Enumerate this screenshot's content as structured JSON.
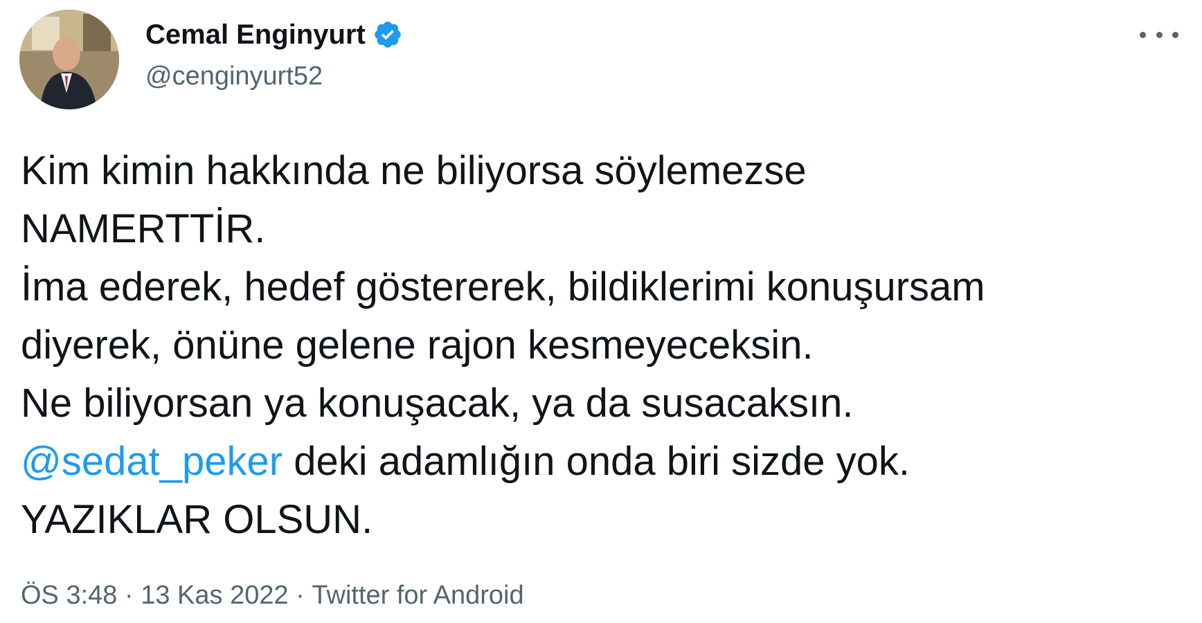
{
  "author": {
    "name": "Cemal Enginyurt",
    "handle": "@cenginyurt52",
    "verified_icon": "verified-badge-icon"
  },
  "more_icon": "more-horizontal-icon",
  "tweet": {
    "lines": [
      "Kim kimin hakkında ne biliyorsa söylemezse",
      "NAMERTTİR.",
      "İma ederek, hedef göstererek, bildiklerimi konuşursam",
      "diyerek, önüne gelene rajon kesmeyeceksin.",
      "Ne biliyorsan ya konuşacak, ya da susacaksın."
    ],
    "mention": "@sedat_peker",
    "mention_rest": " deki adamlığın onda biri sizde yok.",
    "last_line": "YAZIKLAR OLSUN."
  },
  "meta": {
    "time": "ÖS 3:48",
    "separator": " · ",
    "date": "13 Kas 2022",
    "source": "Twitter for Android"
  },
  "colors": {
    "text": "#0f1419",
    "secondary": "#536471",
    "accent": "#1d9bf0"
  }
}
